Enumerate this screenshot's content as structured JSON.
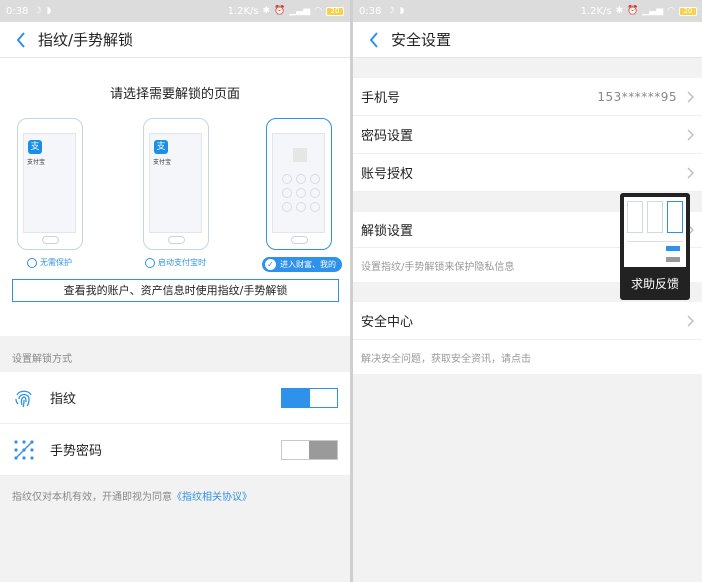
{
  "left": {
    "status": {
      "time": "0:38",
      "speed": "1.2K/s",
      "battery": "20"
    },
    "nav": {
      "title": "指纹/手势解锁"
    },
    "choose": {
      "title": "请选择需要解锁的页面",
      "app_name": "支付宝",
      "logo_char": "支",
      "options": [
        {
          "label": "无需保护",
          "selected": false
        },
        {
          "label": "启动支付宝时",
          "selected": false
        },
        {
          "label": "进入财富、我的",
          "selected": true
        }
      ],
      "hint": "查看我的账户、资产信息时使用指纹/手势解锁"
    },
    "method_section": "设置解锁方式",
    "methods": [
      {
        "label": "指纹",
        "icon": "fingerprint-icon",
        "enabled": true
      },
      {
        "label": "手势密码",
        "icon": "gesture-icon",
        "enabled": false
      }
    ],
    "footnote": {
      "text": "指纹仅对本机有效，开通即视为同意",
      "link": "《指纹相关协议》"
    }
  },
  "right": {
    "status": {
      "time": "0:38",
      "speed": "1.2K/s",
      "battery": "20"
    },
    "nav": {
      "title": "安全设置"
    },
    "rows": {
      "phone": {
        "label": "手机号",
        "value": "153******95"
      },
      "password": {
        "label": "密码设置"
      },
      "auth": {
        "label": "账号授权"
      },
      "unlock": {
        "label": "解锁设置",
        "sub": "设置指纹/手势解锁来保护隐私信息"
      },
      "center": {
        "label": "安全中心",
        "sub": "解决安全问题，获取安全资讯，请点击"
      }
    },
    "feedback": {
      "label": "求助反馈"
    }
  },
  "colors": {
    "accent": "#2e91ea",
    "background": "#f2f2f2",
    "toggle_off": "#9a9a9a"
  }
}
